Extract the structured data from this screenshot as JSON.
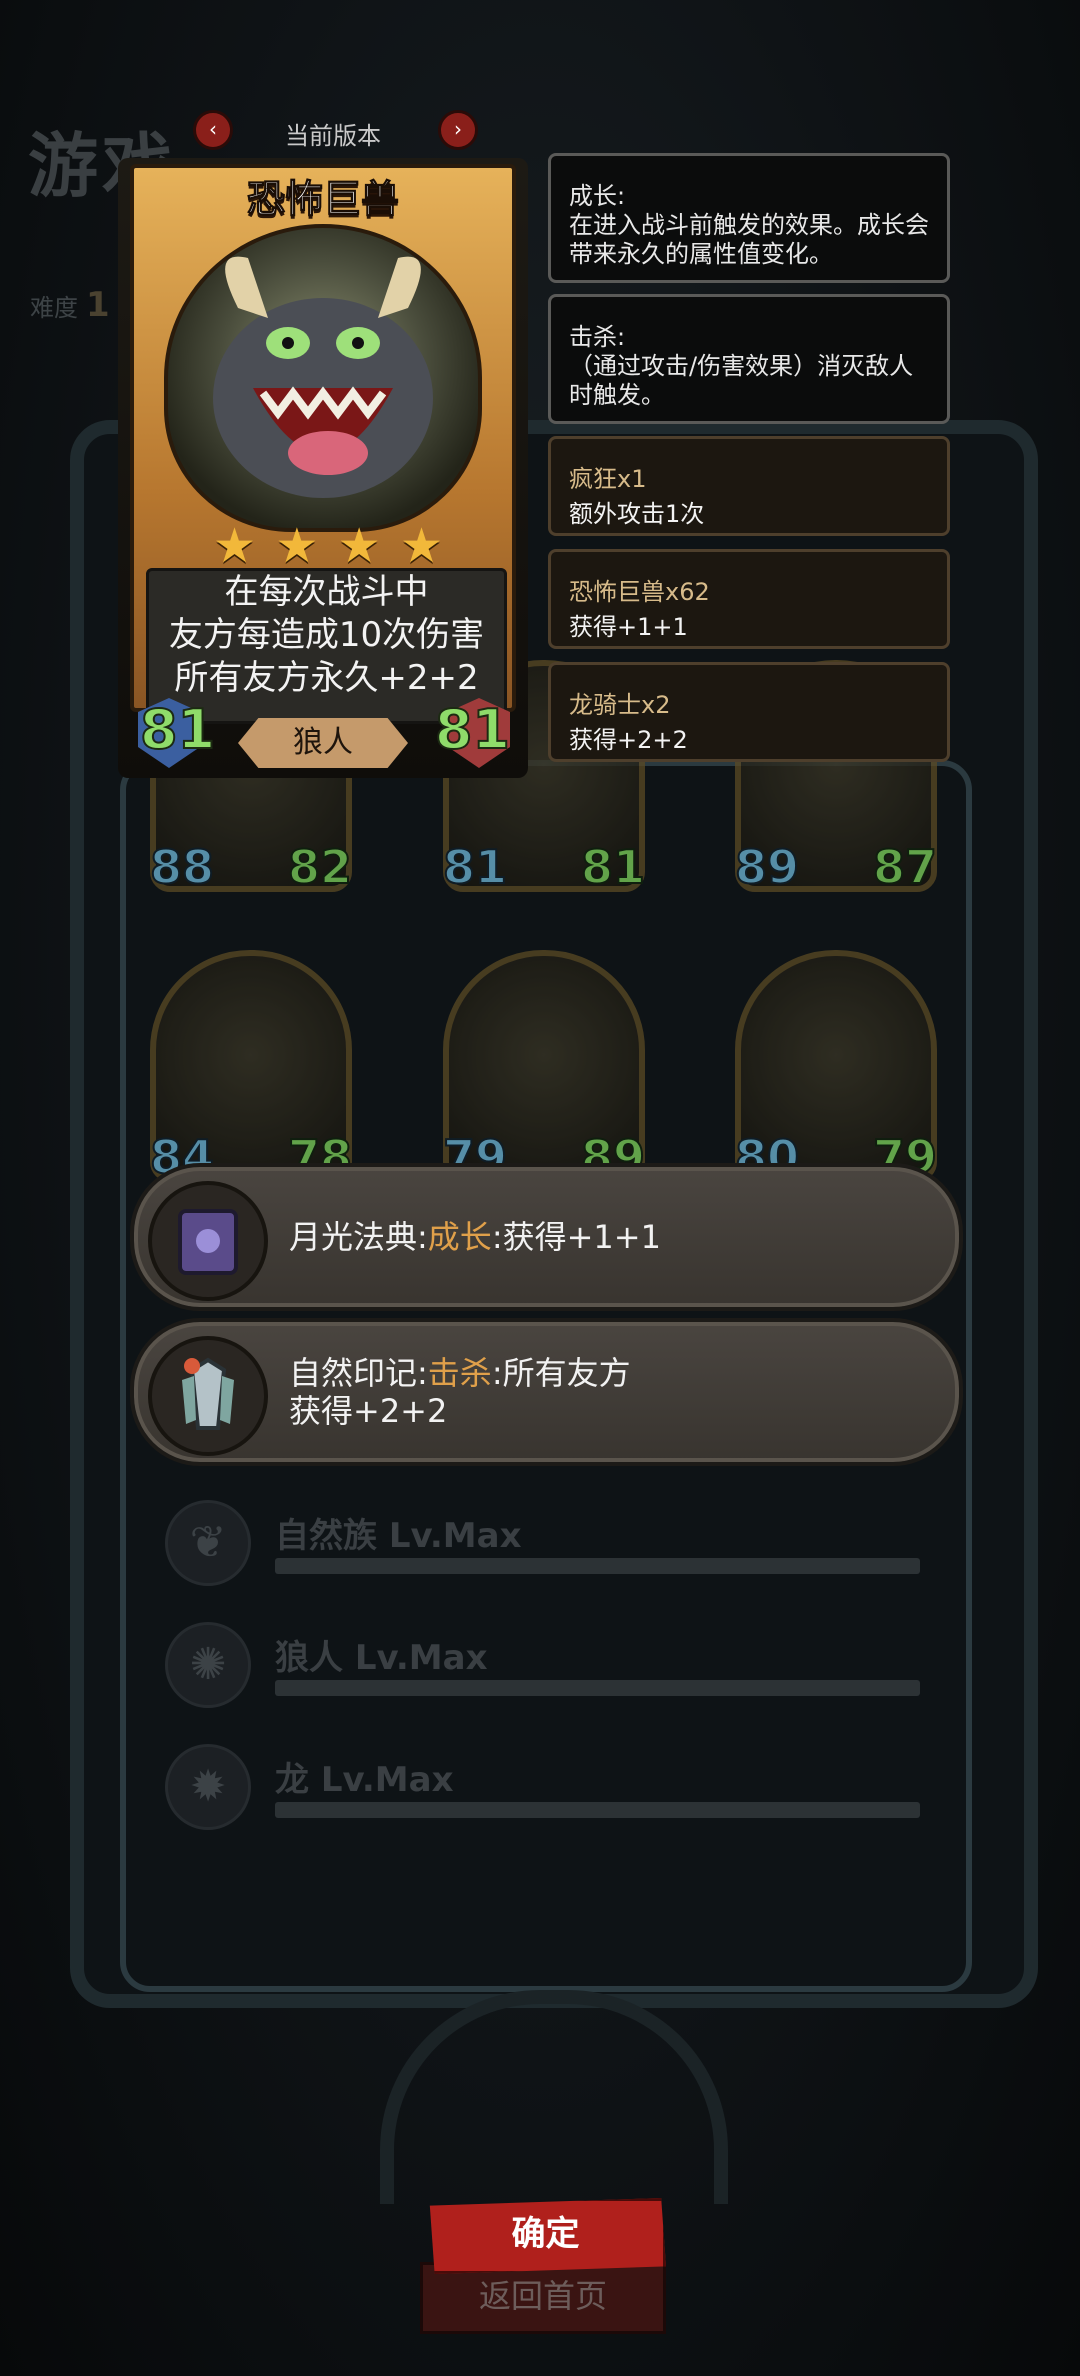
{
  "background": {
    "title": "游戏",
    "difficulty_label": "难度",
    "difficulty_value": "1"
  },
  "version": {
    "label": "当前版本",
    "prev_icon": "chevron-left-icon",
    "next_icon": "chevron-right-icon"
  },
  "card": {
    "name": "恐怖巨兽",
    "stars": 4,
    "description": [
      "在每次战斗中",
      "友方每造成10次伤害",
      "所有友方永久+2+2"
    ],
    "attack": "81",
    "health": "81",
    "tribe": "狼人"
  },
  "tooltips": [
    {
      "title": "成长:",
      "body": "在进入战斗前触发的效果。成长会带来永久的属性值变化。"
    },
    {
      "title": "击杀:",
      "body": "（通过攻击/伤害效果）消灭敌人时触发。"
    }
  ],
  "effects": [
    {
      "name": "疯狂x1",
      "effect": "额外攻击1次"
    },
    {
      "name": "恐怖巨兽x62",
      "effect": "获得+1+1"
    },
    {
      "name": "龙骑士x2",
      "effect": "获得+2+2"
    }
  ],
  "units_row1": [
    {
      "attack": "88",
      "health": "82"
    },
    {
      "attack": "81",
      "health": "81"
    },
    {
      "attack": "89",
      "health": "87"
    }
  ],
  "units_row2": [
    {
      "attack": "84",
      "health": "78"
    },
    {
      "attack": "79",
      "health": "89"
    },
    {
      "attack": "80",
      "health": "79"
    }
  ],
  "relics": [
    {
      "name": "月光法典:",
      "keyword": "成长",
      "text_line1": ":获得+1+1",
      "text_line2": ""
    },
    {
      "name": "自然印记:",
      "keyword": "击杀",
      "text_line1": ":所有友方",
      "text_line2": "获得+2+2"
    }
  ],
  "levels": [
    {
      "label": "自然族 Lv.Max",
      "icon": "nature-emblem-icon"
    },
    {
      "label": "狼人 Lv.Max",
      "icon": "wolf-emblem-icon"
    },
    {
      "label": "龙 Lv.Max",
      "icon": "dragon-emblem-icon"
    }
  ],
  "buttons": {
    "confirm": "确定",
    "home": "返回首页"
  },
  "colors": {
    "attack": "#6fb8d8",
    "health": "#7ed35c",
    "keyword": "#e0a04a",
    "gold": "#e6b25a",
    "confirm": "#b0201c"
  }
}
